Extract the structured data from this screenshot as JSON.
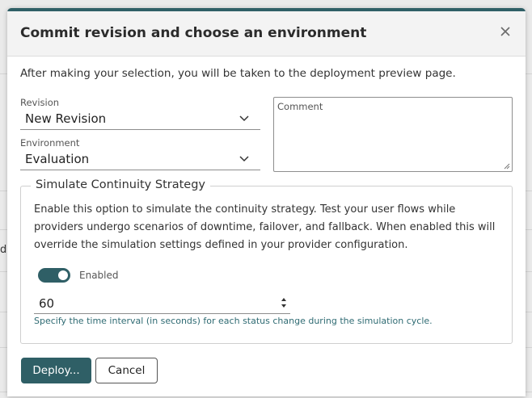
{
  "background": {
    "partial_text": "d"
  },
  "dialog": {
    "title": "Commit revision and choose an environment",
    "intro": "After making your selection, you will be taken to the deployment preview page.",
    "revision": {
      "label": "Revision",
      "value": "New Revision"
    },
    "environment": {
      "label": "Environment",
      "value": "Evaluation"
    },
    "comment": {
      "placeholder": "Comment"
    },
    "simulation": {
      "legend": "Simulate Continuity Strategy",
      "description": "Enable this option to simulate the continuity strategy. Test your user flows while providers undergo scenarios of downtime, failover, and fallback. When enabled this will override the simulation settings defined in your provider configuration.",
      "toggle_label": "Enabled",
      "toggle_on": true,
      "interval_value": "60",
      "interval_hint": "Specify the time interval (in seconds) for each status change during the simulation cycle."
    },
    "buttons": {
      "deploy": "Deploy...",
      "cancel": "Cancel"
    }
  },
  "colors": {
    "accent": "#2f5f66",
    "hint": "#2f6b73"
  }
}
